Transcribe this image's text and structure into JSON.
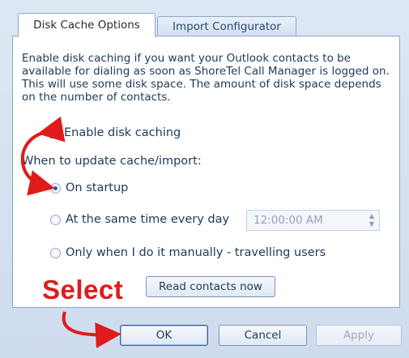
{
  "tabs": [
    {
      "label": "Disk Cache Options",
      "active": true
    },
    {
      "label": "Import Configurator",
      "active": false
    }
  ],
  "description": "Enable disk caching if you want your Outlook contacts to be available for dialing as soon as ShoreTel Call Manager is logged on. This will use some disk space. The amount of disk space depends on the number of contacts.",
  "enable_caching": {
    "label": "Enable disk caching",
    "checked": true
  },
  "update_section_label": "When to update cache/import:",
  "radios": [
    {
      "label": "On startup",
      "checked": true
    },
    {
      "label": "At the same time every day",
      "checked": false
    },
    {
      "label": "Only when I do it manually - travelling users",
      "checked": false
    }
  ],
  "time_field": {
    "value": "12:00:00 AM"
  },
  "read_contacts_button": "Read contacts now",
  "annotation": {
    "text": "Select",
    "color": "#e01b1b"
  },
  "buttons": {
    "ok": "OK",
    "cancel": "Cancel",
    "apply": "Apply"
  },
  "icons": {
    "spin_up": "spin-up-icon",
    "spin_down": "spin-down-icon"
  }
}
